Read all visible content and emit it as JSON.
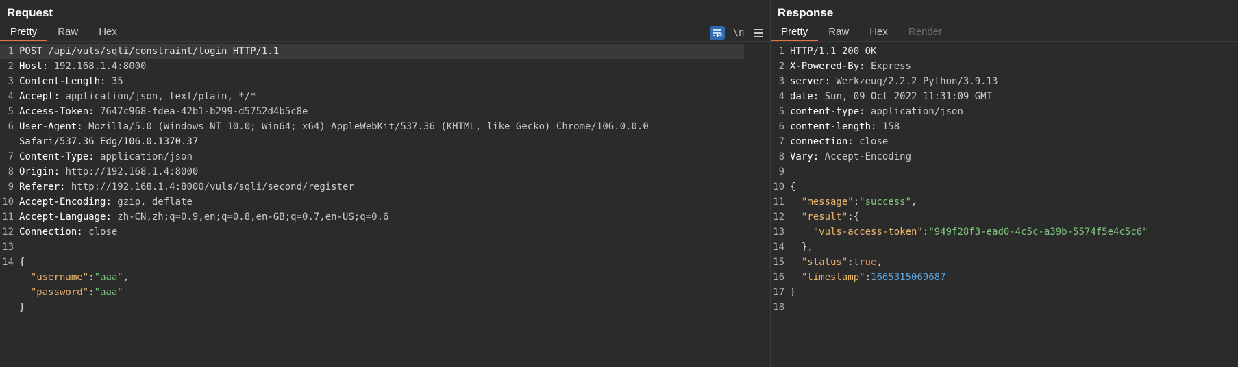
{
  "request": {
    "title": "Request",
    "tabs": [
      "Pretty",
      "Raw",
      "Hex"
    ],
    "active_tab": "Pretty",
    "toolbar": {
      "wrap_icon": "wrap-lines-icon",
      "newline_label": "\\n",
      "menu_icon": "hamburger-menu-icon"
    },
    "lines": [
      {
        "n": "1",
        "text": "POST /api/vuls/sqli/constraint/login HTTP/1.1"
      },
      {
        "n": "2",
        "key": "Host",
        "value": " 192.168.1.4:8000"
      },
      {
        "n": "3",
        "key": "Content-Length",
        "value": " 35"
      },
      {
        "n": "4",
        "key": "Accept",
        "value": " application/json, text/plain, */*"
      },
      {
        "n": "5",
        "key": "Access-Token",
        "value": " 7647c968-fdea-42b1-b299-d5752d4b5c8e"
      },
      {
        "n": "6",
        "key": "User-Agent",
        "value": " Mozilla/5.0 (Windows NT 10.0; Win64; x64) AppleWebKit/537.36 (KHTML, like Gecko) Chrome/106.0.0.0"
      },
      {
        "n": "",
        "text": "Safari/537.36 Edg/106.0.1370.37"
      },
      {
        "n": "7",
        "key": "Content-Type",
        "value": " application/json"
      },
      {
        "n": "8",
        "key": "Origin",
        "value": " http://192.168.1.4:8000"
      },
      {
        "n": "9",
        "key": "Referer",
        "value": " http://192.168.1.4:8000/vuls/sqli/second/register"
      },
      {
        "n": "10",
        "key": "Accept-Encoding",
        "value": " gzip, deflate"
      },
      {
        "n": "11",
        "key": "Accept-Language",
        "value": " zh-CN,zh;q=0.9,en;q=0.8,en-GB;q=0.7,en-US;q=0.6"
      },
      {
        "n": "12",
        "key": "Connection",
        "value": " close"
      },
      {
        "n": "13",
        "text": ""
      },
      {
        "n": "14",
        "text": "{"
      },
      {
        "n": "",
        "indent": "  ",
        "jkey": "\"username\"",
        "colon": ":",
        "jstr": "\"aaa\"",
        "tail": ","
      },
      {
        "n": "",
        "indent": "  ",
        "jkey": "\"password\"",
        "colon": ":",
        "jstr": "\"aaa\"",
        "tail": ""
      },
      {
        "n": "",
        "text": "}"
      }
    ]
  },
  "response": {
    "title": "Response",
    "tabs": [
      "Pretty",
      "Raw",
      "Hex",
      "Render"
    ],
    "active_tab": "Pretty",
    "lines": [
      {
        "n": "1",
        "text": "HTTP/1.1 200 OK"
      },
      {
        "n": "2",
        "key": "X-Powered-By",
        "value": " Express"
      },
      {
        "n": "3",
        "key": "server",
        "value": " Werkzeug/2.2.2 Python/3.9.13"
      },
      {
        "n": "4",
        "key": "date",
        "value": " Sun, 09 Oct 2022 11:31:09 GMT"
      },
      {
        "n": "5",
        "key": "content-type",
        "value": " application/json"
      },
      {
        "n": "6",
        "key": "content-length",
        "value": " 158"
      },
      {
        "n": "7",
        "key": "connection",
        "value": " close"
      },
      {
        "n": "8",
        "key": "Vary",
        "value": " Accept-Encoding"
      },
      {
        "n": "9",
        "text": ""
      },
      {
        "n": "10",
        "text": "{"
      },
      {
        "n": "11",
        "indent": "  ",
        "jkey": "\"message\"",
        "colon": ":",
        "jstr": "\"success\"",
        "tail": ","
      },
      {
        "n": "12",
        "indent": "  ",
        "jkey": "\"result\"",
        "colon": ":",
        "tail": "{"
      },
      {
        "n": "13",
        "indent": "    ",
        "jkey": "\"vuls-access-token\"",
        "colon": ":",
        "jstr": "\"949f28f3-ead0-4c5c-a39b-5574f5e4c5c6\"",
        "tail": ""
      },
      {
        "n": "14",
        "text": "  },"
      },
      {
        "n": "15",
        "indent": "  ",
        "jkey": "\"status\"",
        "colon": ":",
        "jbool": "true",
        "tail": ","
      },
      {
        "n": "16",
        "indent": "  ",
        "jkey": "\"timestamp\"",
        "colon": ":",
        "jnum": "1665315069687",
        "tail": ""
      },
      {
        "n": "17",
        "text": "}"
      },
      {
        "n": "18",
        "text": ""
      }
    ]
  },
  "colors": {
    "background": "#2b2b2b",
    "active_tab_underline": "#e8723c",
    "json_key": "#e8b36a",
    "json_string": "#7ec57e",
    "json_bool": "#e0894a",
    "json_number": "#5ba7e6"
  }
}
